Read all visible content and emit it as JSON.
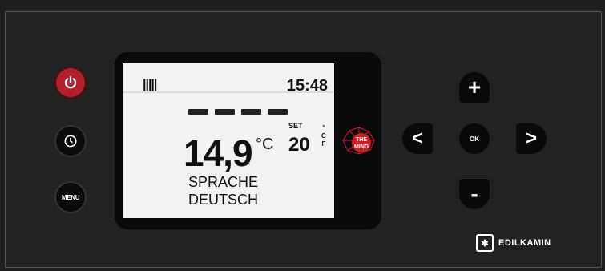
{
  "display": {
    "battery_indicator": "|||||",
    "time": "15:48",
    "room_temperature": "14,9",
    "unit": "°C",
    "set_label": "SET",
    "setpoint": "20",
    "unit_options": [
      "°",
      "C",
      "F"
    ],
    "message_line1": "SPRACHE",
    "message_line2": "DEUTSCH"
  },
  "buttons": {
    "power_icon": "power-icon",
    "clock_icon": "clock-icon",
    "menu_label": "MENU",
    "plus_label": "+",
    "minus_label": "-",
    "left_label": "<",
    "right_label": ">",
    "ok_label": "OK"
  },
  "branding": {
    "the_mind_line1": "THE",
    "the_mind_line2": "MIND",
    "edilkamin": "EDILKAMIN"
  },
  "colors": {
    "power_button": "#b3202b",
    "the_mind_logo": "#d01c24",
    "panel": "#222222",
    "lcd": "#f2f2f2"
  }
}
